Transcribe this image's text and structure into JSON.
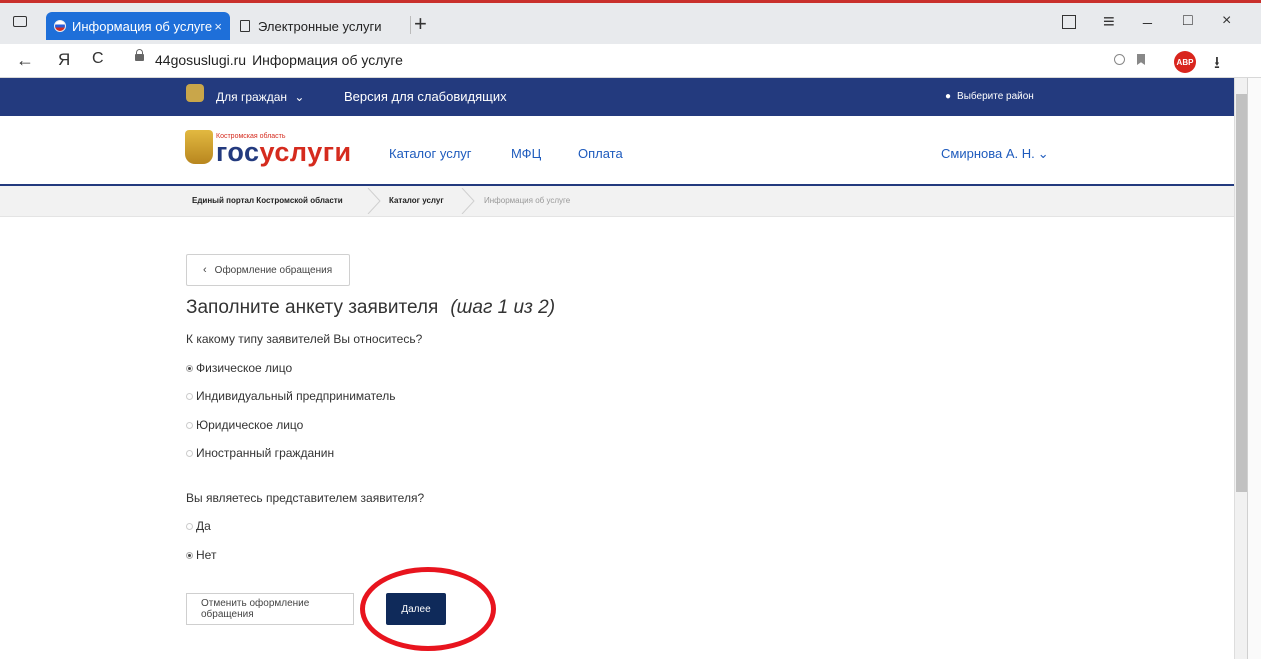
{
  "browser": {
    "tabs": [
      {
        "title": "Информация об услуге",
        "close": "×"
      },
      {
        "title": "Электронные услуги"
      }
    ],
    "new_tab": "+",
    "back": "←",
    "yandex": "Я",
    "reload": "C",
    "url_host": "44gosuslugi.ru",
    "url_page_title": "Информация об услуге",
    "window_controls": {
      "menu": "≡",
      "minimize": "_",
      "maximize": "□",
      "close": "×"
    },
    "download": "⭳",
    "abp": "ABP"
  },
  "site": {
    "topnav": {
      "citizens": "Для граждан",
      "visually_impaired": "Версия для слабовидящих",
      "district": "Выберите район"
    },
    "logo": {
      "region": "Костромская область",
      "gos": "гос",
      "uslugi": "услуги"
    },
    "menu": [
      "Каталог услуг",
      "МФЦ",
      "Оплата"
    ],
    "user": "Смирнова А. Н."
  },
  "breadcrumbs": [
    "Единый портал Костромской области",
    "Каталог услуг",
    "Информация об услуге"
  ],
  "form": {
    "back_label": "Оформление обращения",
    "title": "Заполните анкету заявителя",
    "step": "(шаг 1 из 2)",
    "q1": "К какому типу заявителей Вы относитесь?",
    "q1_options": [
      "Физическое лицо",
      "Индивидуальный предприниматель",
      "Юридическое лицо",
      "Иностранный гражданин"
    ],
    "q1_selected": 0,
    "q2": "Вы являетесь представителем заявителя?",
    "q2_options": [
      "Да",
      "Нет"
    ],
    "q2_selected": 1,
    "cancel_label": "Отменить оформление обращения",
    "next_label": "Далее"
  },
  "colors": {
    "header_bg": "#233a7e",
    "accent_link": "#1e5bbd",
    "next_button": "#0f2a5a",
    "highlight": "#e8141e"
  }
}
